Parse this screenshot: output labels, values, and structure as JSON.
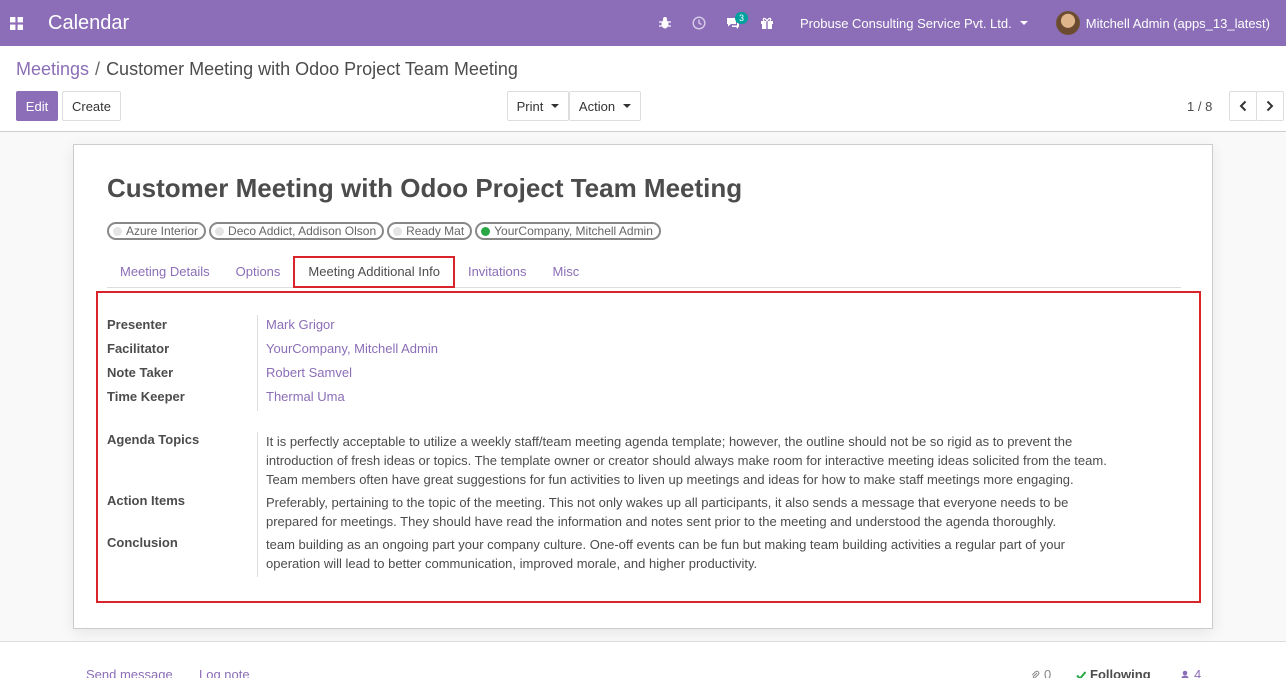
{
  "navbar": {
    "app_title": "Calendar",
    "messages_badge": "3",
    "company": "Probuse Consulting Service Pvt. Ltd.",
    "user": "Mitchell Admin (apps_13_latest)",
    "accent_color": "#8b6eb7"
  },
  "breadcrumb": {
    "parent": "Meetings",
    "separator": "/",
    "current": "Customer Meeting with Odoo Project Team Meeting"
  },
  "toolbar": {
    "edit_label": "Edit",
    "create_label": "Create",
    "print_label": "Print",
    "action_label": "Action",
    "pager_value": "1 / 8"
  },
  "record": {
    "title": "Customer Meeting with Odoo Project Team Meeting",
    "attendees": [
      {
        "label": "Azure Interior",
        "status": "grey"
      },
      {
        "label": "Deco Addict, Addison Olson",
        "status": "grey"
      },
      {
        "label": "Ready Mat",
        "status": "grey"
      },
      {
        "label": "YourCompany, Mitchell Admin",
        "status": "green"
      }
    ],
    "tabs": [
      {
        "label": "Meeting Details"
      },
      {
        "label": "Options"
      },
      {
        "label": "Meeting Additional Info",
        "active": true
      },
      {
        "label": "Invitations"
      },
      {
        "label": "Misc"
      }
    ],
    "fields": {
      "presenter_label": "Presenter",
      "presenter_value": "Mark Grigor",
      "facilitator_label": "Facilitator",
      "facilitator_value": "YourCompany, Mitchell Admin",
      "note_taker_label": "Note Taker",
      "note_taker_value": "Robert Samvel",
      "time_keeper_label": "Time Keeper",
      "time_keeper_value": "Thermal Uma",
      "agenda_label": "Agenda Topics",
      "agenda_value": "It is perfectly acceptable to utilize a weekly staff/team meeting agenda template; however, the outline should not be so rigid as to prevent the introduction of fresh ideas or topics. The template owner or creator should always make room for interactive meeting ideas solicited from the team. Team members often have great suggestions for fun activities to liven up meetings and ideas for how to make staff meetings more engaging.",
      "action_items_label": "Action Items",
      "action_items_value": "Preferably, pertaining to the topic of the meeting. This not only wakes up all participants, it also sends a message that everyone needs to be prepared for meetings. They should have read the information and notes sent prior to the meeting and understood the agenda thoroughly.",
      "conclusion_label": "Conclusion",
      "conclusion_value": "team building as an ongoing part your company culture. One-off events can be fun but making team building activities a regular part of your operation will lead to better communication, improved morale, and higher productivity."
    }
  },
  "chatter": {
    "send_message": "Send message",
    "log_note": "Log note",
    "attachments_count": "0",
    "following_label": "Following",
    "followers_count": "4"
  }
}
